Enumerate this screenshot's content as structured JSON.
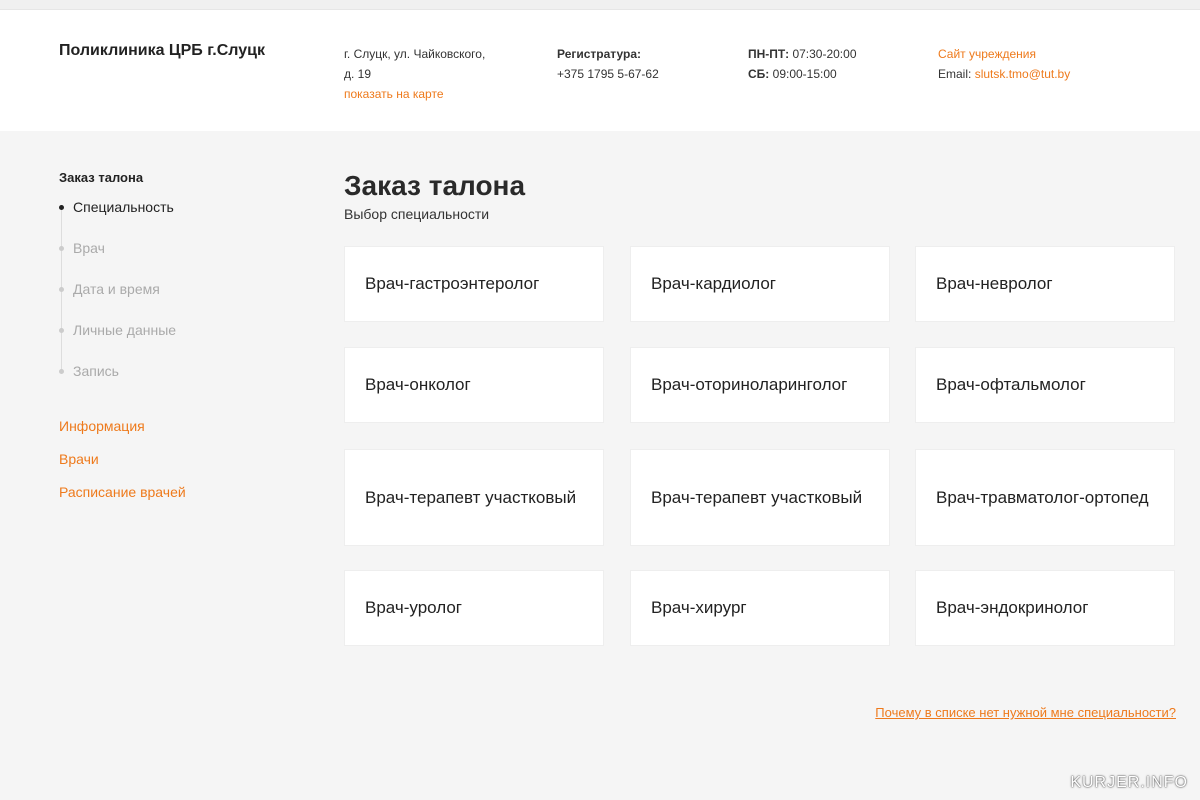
{
  "header": {
    "clinic_name": "Поликлиника ЦРБ г.Слуцк",
    "address_line1": "г. Слуцк, ул. Чайковского,",
    "address_line2": "д. 19",
    "map_link": "показать на карте",
    "registry_label": "Регистратура:",
    "registry_phone": "+375 1795 5-67-62",
    "weekday_label": "ПН-ПТ:",
    "weekday_hours": "07:30-20:00",
    "saturday_label": "СБ:",
    "saturday_hours": "09:00-15:00",
    "site_link": "Сайт учреждения",
    "email_label": "Email:",
    "email_value": "slutsk.tmo@tut.by"
  },
  "sidebar": {
    "title": "Заказ талона",
    "steps": [
      {
        "label": "Специальность",
        "active": true
      },
      {
        "label": "Врач",
        "active": false
      },
      {
        "label": "Дата и время",
        "active": false
      },
      {
        "label": "Личные данные",
        "active": false
      },
      {
        "label": "Запись",
        "active": false
      }
    ],
    "links": [
      "Информация",
      "Врачи",
      "Расписание врачей"
    ]
  },
  "main": {
    "title": "Заказ талона",
    "subtitle": "Выбор специальности",
    "specialties": [
      "Врач-гастроэнтеролог",
      "Врач-кардиолог",
      "Врач-невролог",
      "Врач-онколог",
      "Врач-оториноларинголог",
      "Врач-офтальмолог",
      "Врач-терапевт участковый",
      "Врач-терапевт участковый",
      "Врач-травматолог-ортопед",
      "Врач-уролог",
      "Врач-хирург",
      "Врач-эндокринолог"
    ],
    "help_link": "Почему в списке нет нужной мне специальности?"
  },
  "watermark": "KURJER.INFO",
  "colors": {
    "accent": "#ee7a1c",
    "background": "#f5f5f5",
    "card": "#ffffff"
  }
}
